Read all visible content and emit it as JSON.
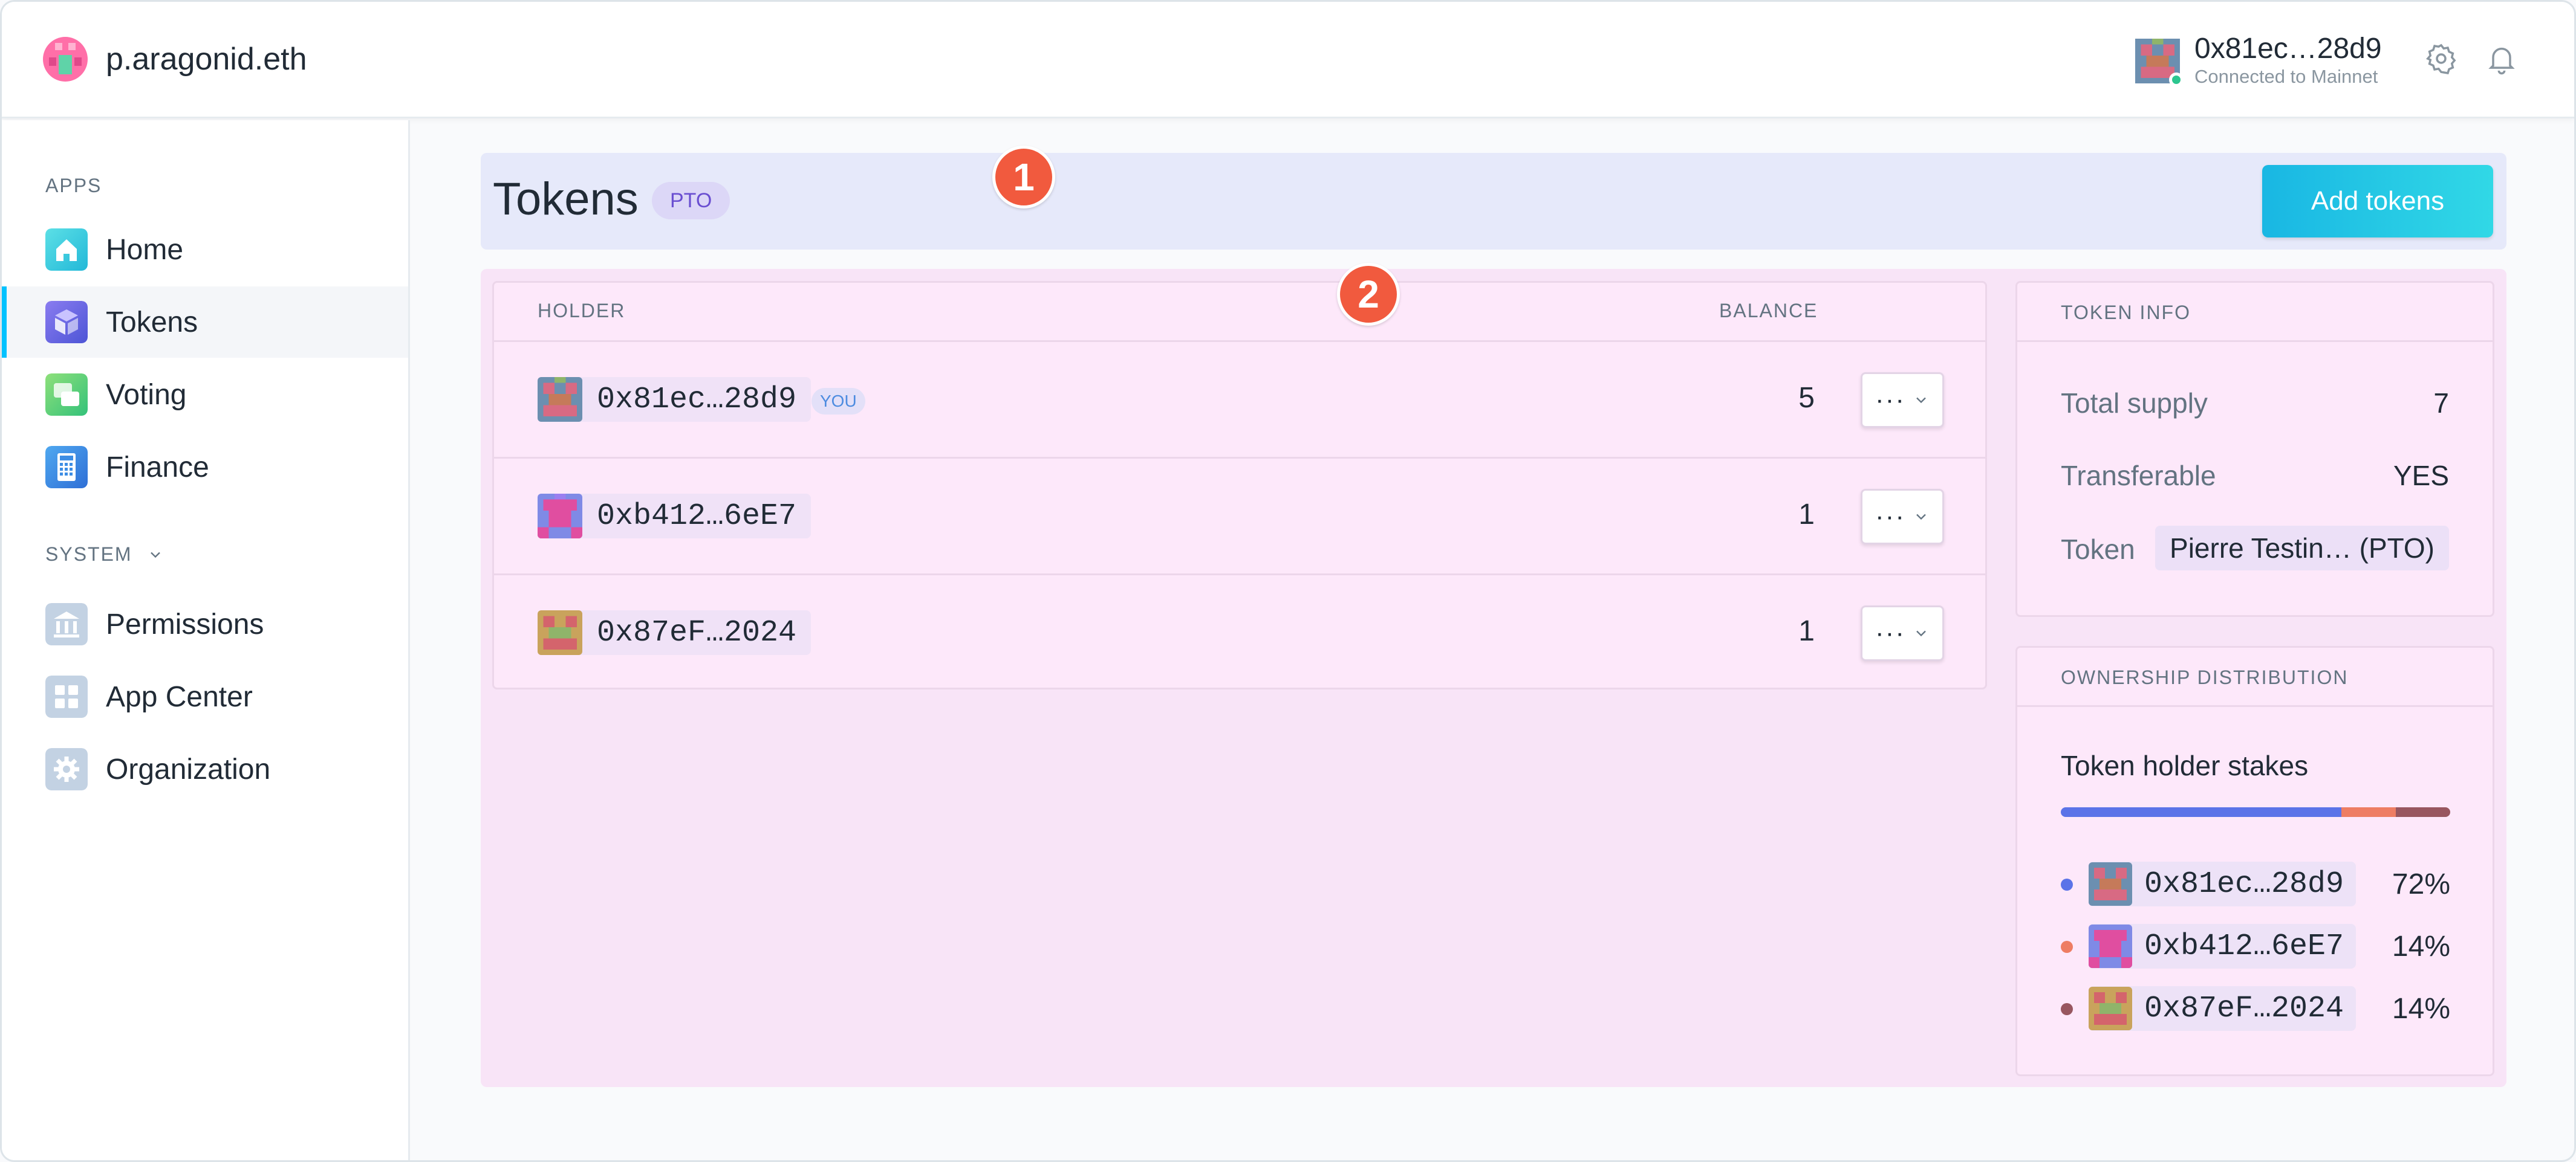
{
  "org": {
    "name": "p.aragonid.eth"
  },
  "account": {
    "address": "0x81ec…28d9",
    "network": "Connected to Mainnet"
  },
  "sidebar": {
    "apps_label": "APPS",
    "system_label": "SYSTEM",
    "apps": [
      {
        "label": "Home",
        "icon": "home-icon"
      },
      {
        "label": "Tokens",
        "icon": "tokens-icon",
        "active": true
      },
      {
        "label": "Voting",
        "icon": "voting-icon"
      },
      {
        "label": "Finance",
        "icon": "finance-icon"
      }
    ],
    "system": [
      {
        "label": "Permissions",
        "icon": "permissions-icon"
      },
      {
        "label": "App Center",
        "icon": "app-center-icon"
      },
      {
        "label": "Organization",
        "icon": "organization-icon"
      }
    ]
  },
  "header": {
    "title": "Tokens",
    "badge": "PTO",
    "add_button": "Add tokens",
    "marker": "1"
  },
  "holders": {
    "marker": "2",
    "col_holder": "HOLDER",
    "col_balance": "BALANCE",
    "menu_dots": "···",
    "rows": [
      {
        "address": "0x81ec…28d9",
        "you": "YOU",
        "balance": "5"
      },
      {
        "address": "0xb412…6eE7",
        "balance": "1"
      },
      {
        "address": "0x87eF…2024",
        "balance": "1"
      }
    ]
  },
  "token_info": {
    "title": "TOKEN INFO",
    "total_supply_label": "Total supply",
    "total_supply": "7",
    "transferable_label": "Transferable",
    "transferable": "YES",
    "token_label": "Token",
    "token": "Pierre Testin… (PTO)"
  },
  "ownership": {
    "title": "OWNERSHIP DISTRIBUTION",
    "subtitle": "Token holder stakes",
    "stakes": [
      {
        "address": "0x81ec…28d9",
        "percent": "72%",
        "value": 0.72,
        "color": "#5b73e8"
      },
      {
        "address": "0xb412…6eE7",
        "percent": "14%",
        "value": 0.14,
        "color": "#ee7d63"
      },
      {
        "address": "0x87eF…2024",
        "percent": "14%",
        "value": 0.14,
        "color": "#98565f"
      }
    ]
  },
  "colors": {
    "accent": "#00c2ff",
    "marker": "#f15a3e",
    "button": "#19b7e3"
  }
}
